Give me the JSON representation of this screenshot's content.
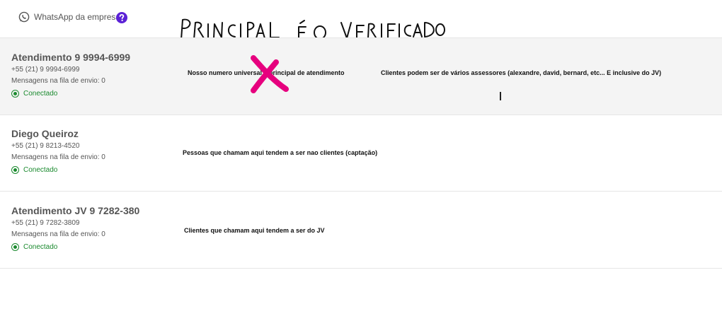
{
  "header": {
    "whatsapp_label": "WhatsApp da empresa",
    "handwritten_note": "PRINCIPAL É O VERIFICADO"
  },
  "accounts": [
    {
      "name": "Atendimento 9 9994-6999",
      "phone": "+55 (21) 9 9994-6999",
      "queue": "Mensagens na fila de envio: 0",
      "status": "Conectado",
      "note1": "Nosso numero universal e principal de atendimento",
      "note2": "Clientes podem ser de vários assessores (alexandre, david, bernard, etc... E inclusive do JV)"
    },
    {
      "name": "Diego Queiroz",
      "phone": "+55 (21) 9 8213-4520",
      "queue": "Mensagens na fila de envio: 0",
      "status": "Conectado",
      "note1": "Pessoas que chamam aqui tendem a ser nao clientes (captação)"
    },
    {
      "name": "Atendimento JV 9 7282-380",
      "phone": "+55 (21) 9 7282-3809",
      "queue": "Mensagens na fila de envio: 0",
      "status": "Conectado",
      "note1": "Clientes que chamam aqui tendem a ser do JV"
    }
  ],
  "colors": {
    "status_green": "#1b8a2f",
    "help_purple": "#5b21d6",
    "annotation_pink": "#e6007e"
  }
}
